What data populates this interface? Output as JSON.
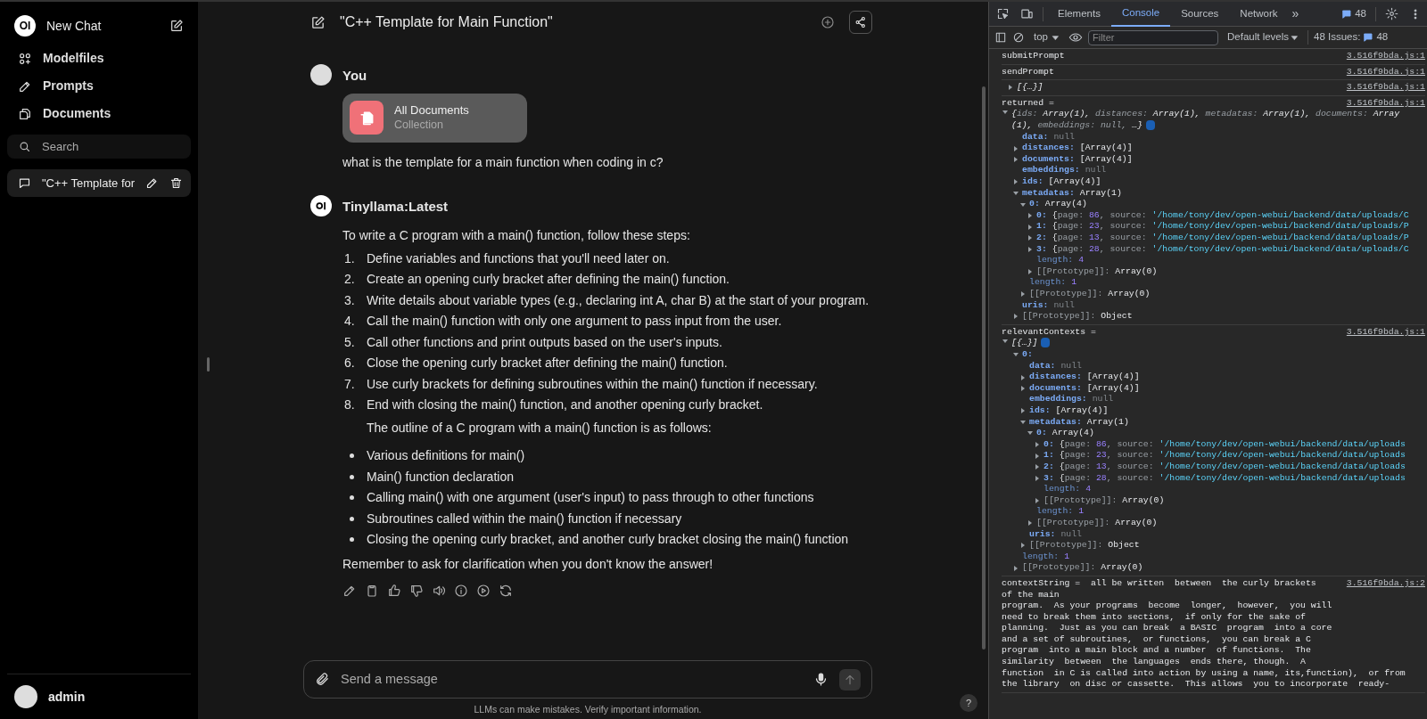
{
  "sidebar": {
    "logo_text": "OI",
    "new_chat": "New Chat",
    "nav": [
      {
        "kind": "models",
        "label": "Modelfiles"
      },
      {
        "kind": "prompts",
        "label": "Prompts"
      },
      {
        "kind": "documents",
        "label": "Documents"
      }
    ],
    "search": {
      "placeholder": "Search"
    },
    "chats": [
      {
        "title": "\"C++ Template for",
        "selected": true
      }
    ],
    "user": {
      "name": "admin"
    }
  },
  "chat": {
    "title": "\"C++ Template for Main Function\"",
    "messages": [
      {
        "kind": "user",
        "author": "You",
        "attachment": {
          "title": "All Documents",
          "subtitle": "Collection"
        },
        "text": "what is the template for a main function when coding in c?"
      },
      {
        "kind": "assistant",
        "author": "Tinyllama:Latest",
        "blocks": [
          {
            "kind": "paragraph",
            "text": "To write a C program with a main() function, follow these steps:"
          },
          {
            "kind": "ordered",
            "items": [
              {
                "number": "1.",
                "text": "Define variables and functions that you'll need later on."
              },
              {
                "number": "2.",
                "text": "Create an opening curly bracket after defining the main() function."
              },
              {
                "number": "3.",
                "text": "Write details about variable types (e.g., declaring int A, char B) at the start of your program."
              },
              {
                "number": "4.",
                "text": "Call the main() function with only one argument to pass input from the user."
              },
              {
                "number": "5.",
                "text": "Call other functions and print outputs based on the user's inputs."
              },
              {
                "number": "6.",
                "text": "Close the opening curly bracket after defining the main() function."
              },
              {
                "number": "7.",
                "text": "Use curly brackets for defining subroutines within the main() function if necessary."
              },
              {
                "number": "8.",
                "text": "End with closing the main() function, and another opening curly bracket."
              }
            ]
          },
          {
            "kind": "indented",
            "text": "The outline of a C program with a main() function is as follows:"
          },
          {
            "kind": "bullets",
            "items": [
              {
                "text": "Various definitions for main()"
              },
              {
                "text": "Main() function declaration"
              },
              {
                "text": "Calling main() with one argument (user's input) to pass through to other functions"
              },
              {
                "text": "Subroutines called within the main() function if necessary"
              },
              {
                "text": "Closing the opening curly bracket, and another curly bracket closing the main() function"
              }
            ]
          },
          {
            "kind": "paragraph",
            "text": "Remember to ask for clarification when you don't know the answer!"
          }
        ],
        "actions": [
          {
            "kind": "edit"
          },
          {
            "kind": "copy"
          },
          {
            "kind": "like"
          },
          {
            "kind": "dislike"
          },
          {
            "kind": "speak"
          },
          {
            "kind": "info"
          },
          {
            "kind": "play"
          },
          {
            "kind": "regenerate"
          }
        ]
      }
    ],
    "input": {
      "placeholder": "Send a message"
    },
    "disclaimer": "LLMs can make mistakes. Verify important information.",
    "help": "?"
  },
  "devtools": {
    "tabs": [
      {
        "label": "Elements",
        "selected": false
      },
      {
        "label": "Console",
        "selected": true
      },
      {
        "label": "Sources",
        "selected": false
      },
      {
        "label": "Network",
        "selected": false
      }
    ],
    "more": "»",
    "messages_count": "48",
    "context": "top",
    "filter": {
      "placeholder": "Filter"
    },
    "levels": "Default levels",
    "issues_label": "48 Issues:",
    "issues_count": "48",
    "entries": [
      {
        "kind": "text",
        "text": "submitPrompt",
        "source": "3.516f9bda.js:1"
      },
      {
        "kind": "text",
        "text": "sendPrompt",
        "source": "3.516f9bda.js:1"
      },
      {
        "kind": "tree",
        "source": "3.516f9bda.js:1",
        "root": {
          "expanded": false,
          "value": [
            {
              "text": "[{…}]",
              "kind": "italic"
            }
          ]
        }
      },
      {
        "kind": "tree",
        "label": "returned =",
        "source": "3.516f9bda.js:1",
        "root": {
          "expanded": true,
          "info": true,
          "value": [
            {
              "text": "{",
              "kind": "italic"
            },
            {
              "text": "ids: ",
              "kind": "pkey"
            },
            {
              "text": "Array(1), ",
              "kind": "italic"
            },
            {
              "text": "distances: ",
              "kind": "pkey"
            },
            {
              "text": "Array(1), ",
              "kind": "italic"
            },
            {
              "text": "metadatas: ",
              "kind": "pkey"
            },
            {
              "text": "Array(1), ",
              "kind": "italic"
            },
            {
              "text": "documents: ",
              "kind": "pkey"
            },
            {
              "text": "Array (1), ",
              "kind": "italic"
            },
            {
              "text": "embeddings: ",
              "kind": "pkey"
            },
            {
              "text": "null, ",
              "kind": "pkey"
            },
            {
              "text": "…}",
              "kind": "italic"
            }
          ],
          "children": [
            {
              "key": "data:",
              "kind": "own",
              "value": [
                {
                  "text": "null",
                  "kind": "null"
                }
              ]
            },
            {
              "key": "distances:",
              "kind": "own",
              "expanded": false,
              "value": [
                {
                  "text": "[Array(4)]",
                  "kind": "plain"
                }
              ]
            },
            {
              "key": "documents:",
              "kind": "own",
              "expanded": false,
              "value": [
                {
                  "text": "[Array(4)]",
                  "kind": "plain"
                }
              ]
            },
            {
              "key": "embeddings:",
              "kind": "own",
              "value": [
                {
                  "text": "null",
                  "kind": "null"
                }
              ]
            },
            {
              "key": "ids:",
              "kind": "own",
              "expanded": false,
              "value": [
                {
                  "text": "[Array(4)]",
                  "kind": "plain"
                }
              ]
            },
            {
              "key": "metadatas:",
              "kind": "own",
              "expanded": true,
              "value": [
                {
                  "text": "Array(1)",
                  "kind": "plain"
                }
              ],
              "children": [
                {
                  "key": "0:",
                  "kind": "own",
                  "expanded": true,
                  "value": [
                    {
                      "text": "Array(4)",
                      "kind": "plain"
                    }
                  ],
                  "children": [
                    {
                      "key": "0:",
                      "kind": "own",
                      "expanded": false,
                      "value": [
                        {
                          "text": "{",
                          "kind": "plain"
                        },
                        {
                          "text": "page: ",
                          "kind": "dim"
                        },
                        {
                          "text": "86",
                          "kind": "number"
                        },
                        {
                          "text": ", source: ",
                          "kind": "dim"
                        },
                        {
                          "text": "'/home/tony/dev/open-webui/backend/data/uploads/C",
                          "kind": "string"
                        }
                      ]
                    },
                    {
                      "key": "1:",
                      "kind": "own",
                      "expanded": false,
                      "value": [
                        {
                          "text": "{",
                          "kind": "plain"
                        },
                        {
                          "text": "page: ",
                          "kind": "dim"
                        },
                        {
                          "text": "23",
                          "kind": "number"
                        },
                        {
                          "text": ", source: ",
                          "kind": "dim"
                        },
                        {
                          "text": "'/home/tony/dev/open-webui/backend/data/uploads/P",
                          "kind": "string"
                        }
                      ]
                    },
                    {
                      "key": "2:",
                      "kind": "own",
                      "expanded": false,
                      "value": [
                        {
                          "text": "{",
                          "kind": "plain"
                        },
                        {
                          "text": "page: ",
                          "kind": "dim"
                        },
                        {
                          "text": "13",
                          "kind": "number"
                        },
                        {
                          "text": ", source: ",
                          "kind": "dim"
                        },
                        {
                          "text": "'/home/tony/dev/open-webui/backend/data/uploads/P",
                          "kind": "string"
                        }
                      ]
                    },
                    {
                      "key": "3:",
                      "kind": "own",
                      "expanded": false,
                      "value": [
                        {
                          "text": "{",
                          "kind": "plain"
                        },
                        {
                          "text": "page: ",
                          "kind": "dim"
                        },
                        {
                          "text": "28",
                          "kind": "number"
                        },
                        {
                          "text": ", source: ",
                          "kind": "dim"
                        },
                        {
                          "text": "'/home/tony/dev/open-webui/backend/data/uploads/C",
                          "kind": "string"
                        }
                      ]
                    },
                    {
                      "key": "length:",
                      "kind": "dim",
                      "value": [
                        {
                          "text": "4",
                          "kind": "number"
                        }
                      ]
                    },
                    {
                      "key": "[[Prototype]]:",
                      "kind": "internal",
                      "expanded": false,
                      "value": [
                        {
                          "text": "Array(0)",
                          "kind": "plain"
                        }
                      ]
                    }
                  ]
                },
                {
                  "key": "length:",
                  "kind": "dim",
                  "value": [
                    {
                      "text": "1",
                      "kind": "number"
                    }
                  ]
                },
                {
                  "key": "[[Prototype]]:",
                  "kind": "internal",
                  "expanded": false,
                  "value": [
                    {
                      "text": "Array(0)",
                      "kind": "plain"
                    }
                  ]
                }
              ]
            },
            {
              "key": "uris:",
              "kind": "own",
              "value": [
                {
                  "text": "null",
                  "kind": "null"
                }
              ]
            },
            {
              "key": "[[Prototype]]:",
              "kind": "internal",
              "expanded": false,
              "value": [
                {
                  "text": "Object",
                  "kind": "plain"
                }
              ]
            }
          ]
        }
      },
      {
        "kind": "tree",
        "label": "relevantContexts =",
        "source": "3.516f9bda.js:1",
        "root": {
          "expanded": true,
          "info": true,
          "value": [
            {
              "text": "[{…}]",
              "kind": "italic"
            }
          ],
          "children": [
            {
              "key": "0:",
              "kind": "own",
              "expanded": true,
              "children": [
                {
                  "key": "data:",
                  "kind": "own",
                  "value": [
                    {
                      "text": "null",
                      "kind": "null"
                    }
                  ]
                },
                {
                  "key": "distances:",
                  "kind": "own",
                  "expanded": false,
                  "value": [
                    {
                      "text": "[Array(4)]",
                      "kind": "plain"
                    }
                  ]
                },
                {
                  "key": "documents:",
                  "kind": "own",
                  "expanded": false,
                  "value": [
                    {
                      "text": "[Array(4)]",
                      "kind": "plain"
                    }
                  ]
                },
                {
                  "key": "embeddings:",
                  "kind": "own",
                  "value": [
                    {
                      "text": "null",
                      "kind": "null"
                    }
                  ]
                },
                {
                  "key": "ids:",
                  "kind": "own",
                  "expanded": false,
                  "value": [
                    {
                      "text": "[Array(4)]",
                      "kind": "plain"
                    }
                  ]
                },
                {
                  "key": "metadatas:",
                  "kind": "own",
                  "expanded": true,
                  "value": [
                    {
                      "text": "Array(1)",
                      "kind": "plain"
                    }
                  ],
                  "children": [
                    {
                      "key": "0:",
                      "kind": "own",
                      "expanded": true,
                      "value": [
                        {
                          "text": "Array(4)",
                          "kind": "plain"
                        }
                      ],
                      "children": [
                        {
                          "key": "0:",
                          "kind": "own",
                          "expanded": false,
                          "value": [
                            {
                              "text": "{",
                              "kind": "plain"
                            },
                            {
                              "text": "page: ",
                              "kind": "dim"
                            },
                            {
                              "text": "86",
                              "kind": "number"
                            },
                            {
                              "text": ", source: ",
                              "kind": "dim"
                            },
                            {
                              "text": "'/home/tony/dev/open-webui/backend/data/uploads",
                              "kind": "string"
                            }
                          ]
                        },
                        {
                          "key": "1:",
                          "kind": "own",
                          "expanded": false,
                          "value": [
                            {
                              "text": "{",
                              "kind": "plain"
                            },
                            {
                              "text": "page: ",
                              "kind": "dim"
                            },
                            {
                              "text": "23",
                              "kind": "number"
                            },
                            {
                              "text": ", source: ",
                              "kind": "dim"
                            },
                            {
                              "text": "'/home/tony/dev/open-webui/backend/data/uploads",
                              "kind": "string"
                            }
                          ]
                        },
                        {
                          "key": "2:",
                          "kind": "own",
                          "expanded": false,
                          "value": [
                            {
                              "text": "{",
                              "kind": "plain"
                            },
                            {
                              "text": "page: ",
                              "kind": "dim"
                            },
                            {
                              "text": "13",
                              "kind": "number"
                            },
                            {
                              "text": ", source: ",
                              "kind": "dim"
                            },
                            {
                              "text": "'/home/tony/dev/open-webui/backend/data/uploads",
                              "kind": "string"
                            }
                          ]
                        },
                        {
                          "key": "3:",
                          "kind": "own",
                          "expanded": false,
                          "value": [
                            {
                              "text": "{",
                              "kind": "plain"
                            },
                            {
                              "text": "page: ",
                              "kind": "dim"
                            },
                            {
                              "text": "28",
                              "kind": "number"
                            },
                            {
                              "text": ", source: ",
                              "kind": "dim"
                            },
                            {
                              "text": "'/home/tony/dev/open-webui/backend/data/uploads",
                              "kind": "string"
                            }
                          ]
                        },
                        {
                          "key": "length:",
                          "kind": "dim",
                          "value": [
                            {
                              "text": "4",
                              "kind": "number"
                            }
                          ]
                        },
                        {
                          "key": "[[Prototype]]:",
                          "kind": "internal",
                          "expanded": false,
                          "value": [
                            {
                              "text": "Array(0)",
                              "kind": "plain"
                            }
                          ]
                        }
                      ]
                    },
                    {
                      "key": "length:",
                      "kind": "dim",
                      "value": [
                        {
                          "text": "1",
                          "kind": "number"
                        }
                      ]
                    },
                    {
                      "key": "[[Prototype]]:",
                      "kind": "internal",
                      "expanded": false,
                      "value": [
                        {
                          "text": "Array(0)",
                          "kind": "plain"
                        }
                      ]
                    }
                  ]
                },
                {
                  "key": "uris:",
                  "kind": "own",
                  "value": [
                    {
                      "text": "null",
                      "kind": "null"
                    }
                  ]
                },
                {
                  "key": "[[Prototype]]:",
                  "kind": "internal",
                  "expanded": false,
                  "value": [
                    {
                      "text": "Object",
                      "kind": "plain"
                    }
                  ]
                }
              ]
            },
            {
              "key": "length:",
              "kind": "dim",
              "value": [
                {
                  "text": "1",
                  "kind": "number"
                }
              ]
            },
            {
              "key": "[[Prototype]]:",
              "kind": "internal",
              "expanded": false,
              "value": [
                {
                  "text": "Array(0)",
                  "kind": "plain"
                }
              ]
            }
          ]
        }
      },
      {
        "kind": "text",
        "text": "contextString =  all be written  between  the curly brackets\nof the main\nprogram.  As your programs  become  longer,  however,  you will\nneed to break them into sections,  if only for the sake of\nplanning.  Just as you can break  a BASIC  program  into a core\nand a set of subroutines,  or functions,  you can break a C\nprogram  into a main block and a number  of functions.  The\nsimilarity  between  the languages  ends there, though.  A\nfunction  in C is called into action by using a name, its,function),  or from\nthe library  on disc or cassette.  This allows  you to incorporate  ready-",
        "source": "3.516f9bda.js:2"
      }
    ]
  }
}
